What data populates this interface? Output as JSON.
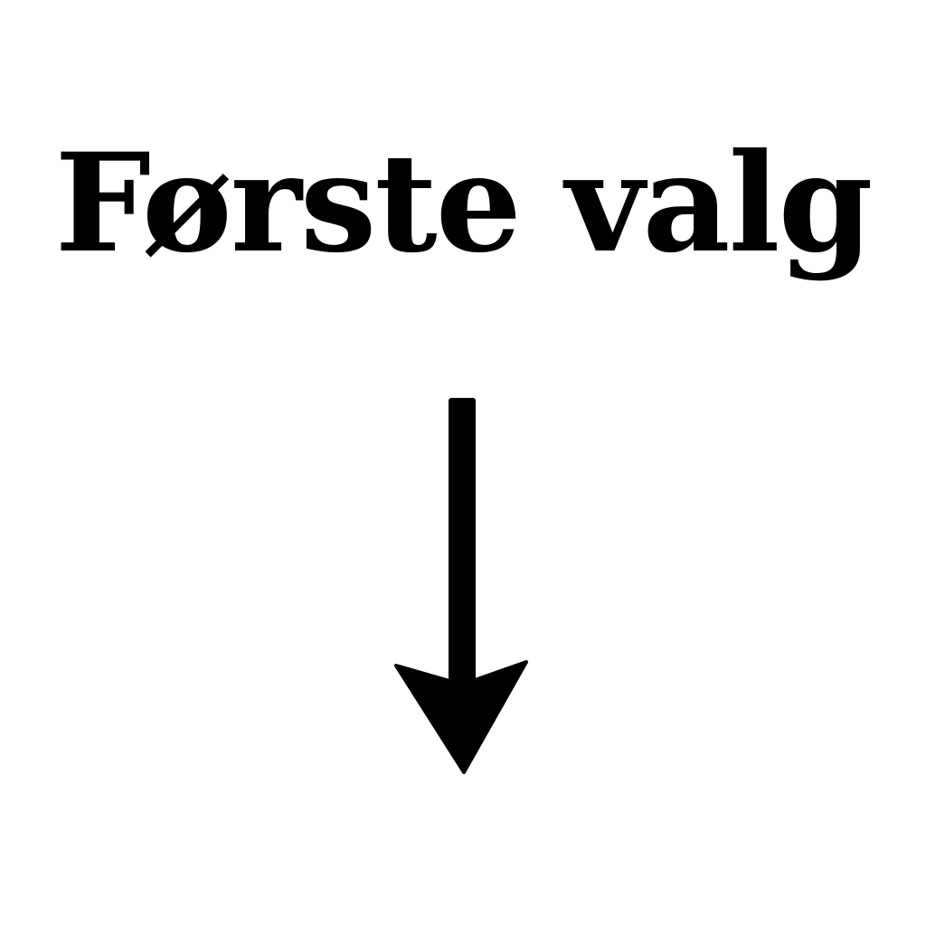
{
  "heading": {
    "text": "Første valg"
  },
  "arrow": {
    "icon": "arrow-down-icon",
    "color": "#000000"
  },
  "background_color": "#ffffff"
}
